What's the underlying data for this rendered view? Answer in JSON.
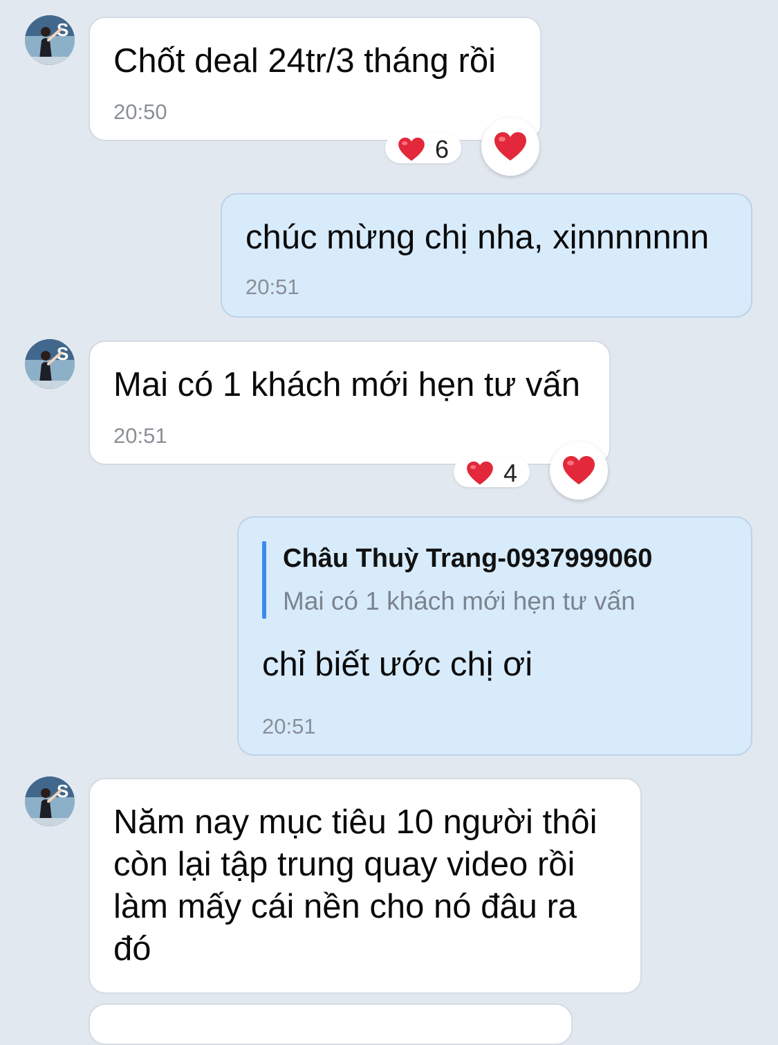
{
  "colors": {
    "background": "#e2e8f0",
    "incoming_bubble": "#ffffff",
    "outgoing_bubble": "#d7ebfb",
    "quote_bar": "#3b8bea",
    "heart": "#e2283a"
  },
  "messages": [
    {
      "direction": "incoming",
      "text": "Chốt deal 24tr/3 tháng rồi",
      "time": "20:50",
      "reaction": {
        "icon": "heart-icon",
        "count": "6"
      }
    },
    {
      "direction": "outgoing",
      "text": "chúc mừng chị nha, xịnnnnnnn",
      "time": "20:51"
    },
    {
      "direction": "incoming",
      "text": "Mai có 1 khách mới hẹn tư vấn",
      "time": "20:51",
      "reaction": {
        "icon": "heart-icon",
        "count": "4"
      }
    },
    {
      "direction": "outgoing",
      "quote": {
        "author": "Châu Thuỳ Trang-0937999060",
        "text": "Mai có 1 khách mới hẹn tư vấn"
      },
      "text": "chỉ biết ước chị ơi",
      "time": "20:51"
    },
    {
      "direction": "incoming",
      "text": "Năm nay mục tiêu 10 người thôi còn lại tập trung quay video rồi làm mấy cái nền cho nó đâu ra đó"
    }
  ]
}
